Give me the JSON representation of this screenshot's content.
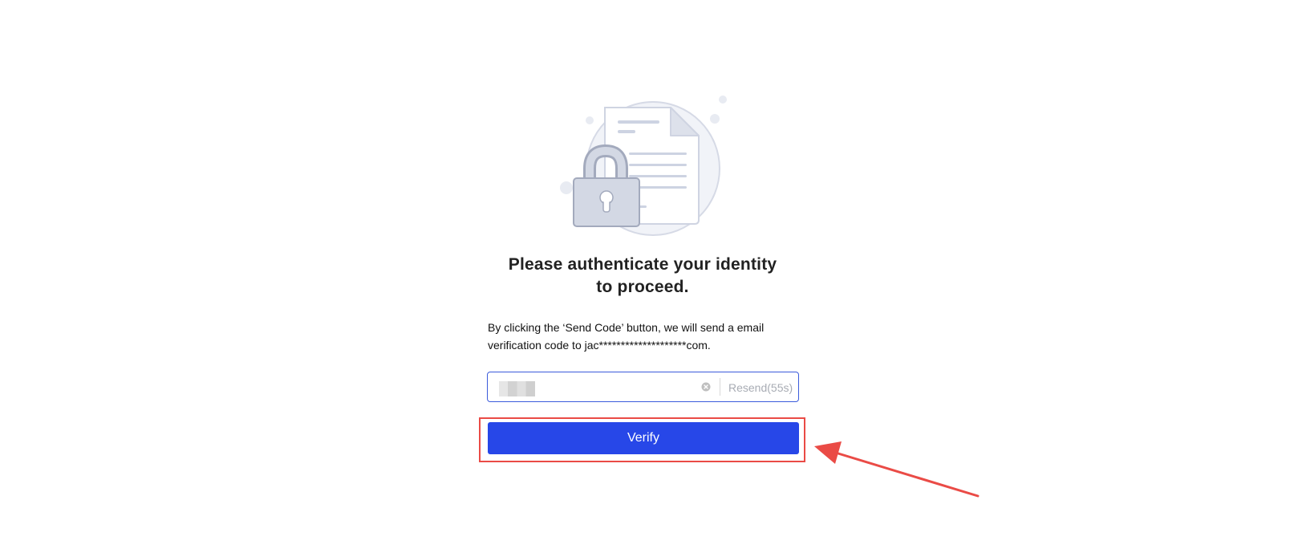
{
  "auth": {
    "title": "Please authenticate your identity to proceed.",
    "description": "By clicking the ‘Send Code’ button, we will send a email verification code to jac********************com.",
    "resend_label": "Resend(55s)",
    "verify_label": "Verify"
  },
  "icons": {
    "illustration": "document-lock-illustration",
    "clear": "clear-circle-icon",
    "annotation": "red-arrow-annotation"
  },
  "colors": {
    "accent": "#2747e8",
    "input_border": "#3b5bdb",
    "annotation": "#ea4b46"
  }
}
